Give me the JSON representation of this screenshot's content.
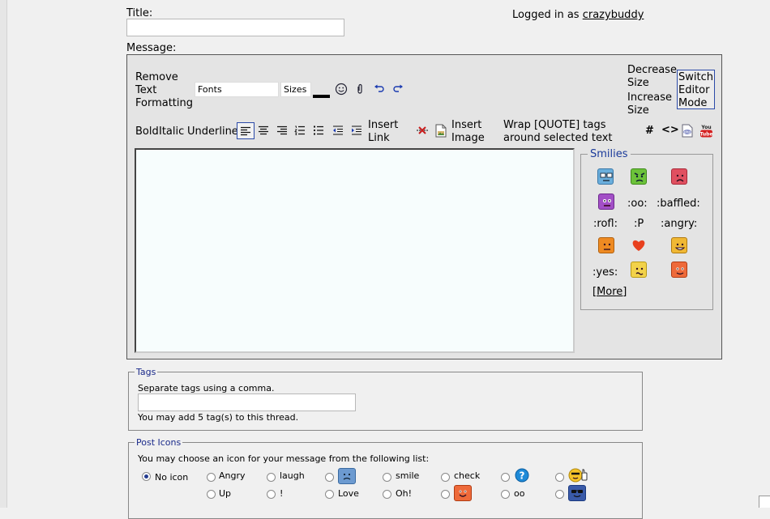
{
  "form": {
    "title_label": "Title:",
    "title_value": "",
    "message_label": "Message:",
    "logged_in_prefix": "Logged in as",
    "username": "crazybuddy"
  },
  "toolbar": {
    "remove_formatting": [
      "Remove",
      "Text",
      "Formatting"
    ],
    "fonts": "Fonts",
    "sizes": "Sizes",
    "decrease_size": [
      "Decrease",
      "Size"
    ],
    "increase_size": [
      "Increase",
      "Size"
    ],
    "switch_mode": [
      "Switch",
      "Editor",
      "Mode"
    ],
    "bold": "Bold",
    "italic": "Italic",
    "underline": "Underline",
    "insert_link": [
      "Insert",
      "Link"
    ],
    "insert_image": [
      "Insert",
      "Image"
    ],
    "wrap_quote": [
      "Wrap [QUOTE] tags",
      "around selected text"
    ],
    "hash": "#",
    "code": "<>",
    "text_color": "#000000"
  },
  "smilies": {
    "legend": "Smilies",
    "texts": [
      ":oo:",
      ":baffled:",
      ":rofl:",
      ":P",
      ":angry:",
      ":yes:"
    ],
    "more": "[More]"
  },
  "tags": {
    "legend": "Tags",
    "hint": "Separate tags using a comma.",
    "value": "",
    "limit": "You may add 5 tag(s) to this thread."
  },
  "post_icons": {
    "legend": "Post Icons",
    "hint": "You may choose an icon for your message from the following list:",
    "labels": [
      "No icon",
      "Angry",
      "laugh",
      "smile",
      "check",
      "Up",
      "!",
      "Love",
      "Oh!",
      "oo"
    ],
    "selected": "No icon"
  },
  "colors": {
    "legend_text": "#1a2a8a",
    "editor_bg": "#e4e4e4",
    "message_bg": "#f7fdfd"
  }
}
